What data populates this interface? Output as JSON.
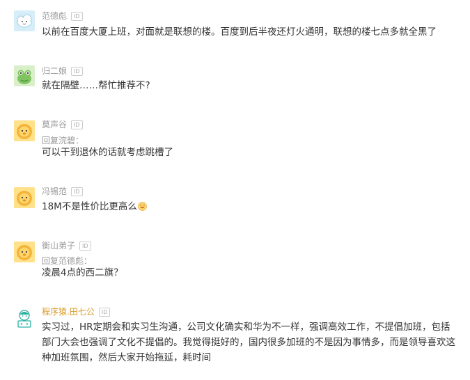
{
  "comments": [
    {
      "username": "范德彪",
      "id_badge": "ID",
      "avatar_icon": "cloud-avatar-icon",
      "text": "以前在百度大厦上班，对面就是联想的楼。百度到后半夜还灯火通明，联想的楼七点多就全黑了"
    },
    {
      "username": "归二娘",
      "id_badge": "ID",
      "avatar_icon": "frog-avatar-icon",
      "text": "就在隔壁……帮忙推荐不?"
    },
    {
      "username": "莫声谷",
      "id_badge": "ID",
      "avatar_icon": "lion-avatar-icon",
      "reply_to": "回复浣碧：",
      "text": "可以干到退休的话就考虑跳槽了"
    },
    {
      "username": "冯锡范",
      "id_badge": "ID",
      "avatar_icon": "lion-avatar-icon",
      "text": "18M不是性价比更高么",
      "emoji_icon": "laugh-emoji-icon"
    },
    {
      "username": "衡山弟子",
      "id_badge": "ID",
      "avatar_icon": "lion-avatar-icon",
      "reply_to": "回复范德彪：",
      "text": "凌晨4点的西二旗？"
    },
    {
      "username": "程序猿.田七公",
      "id_badge": "ID",
      "avatar_icon": "coder-avatar-icon",
      "highlight_color": "#d99b29",
      "text": "实习过，HR定期会和实习生沟通，公司文化确实和华为不一样，强调高效工作，不提倡加班，包括部门大会也强调了文化不提倡的。我觉得挺好的，国内很多加班的不是因为事情多，而是领导喜欢这种加班氛围，然后大家开始拖延，耗时间"
    }
  ]
}
